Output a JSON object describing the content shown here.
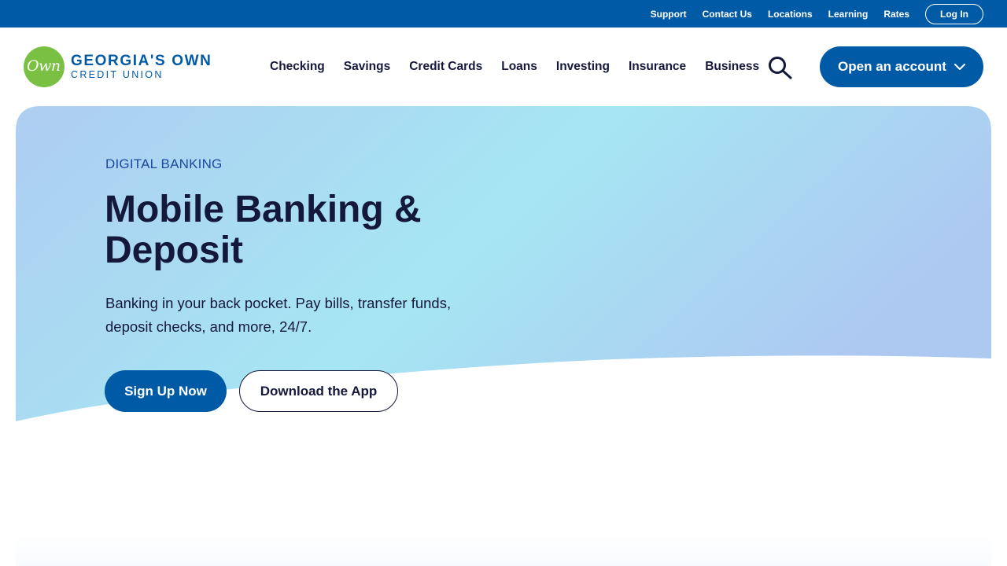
{
  "utility_nav": {
    "links": [
      "Support",
      "Contact Us",
      "Locations",
      "Learning",
      "Rates"
    ],
    "login_label": "Log In"
  },
  "header": {
    "logo_mark_text": "Own",
    "logo_line1": "GEORGIA'S OWN",
    "logo_line2": "CREDIT UNION",
    "nav_items": [
      "Checking",
      "Savings",
      "Credit Cards",
      "Loans",
      "Investing",
      "Insurance",
      "Business"
    ],
    "search_icon": "search-icon",
    "open_account_label": "Open an account",
    "open_account_icon": "chevron-down-icon"
  },
  "hero": {
    "eyebrow": "DIGITAL BANKING",
    "title": "Mobile Banking & Deposit",
    "description": "Banking in your back pocket. Pay bills, transfer funds, deposit checks, and more, 24/7.",
    "primary_cta": "Sign Up Now",
    "secondary_cta": "Download the App"
  },
  "colors": {
    "brand_blue": "#005aa6",
    "navy_text": "#14183a",
    "logo_green": "#7ac143",
    "hero_gradient_start": "#aecdf2",
    "hero_gradient_mid": "#a6e6f3",
    "hero_gradient_end": "#adc9f2"
  }
}
